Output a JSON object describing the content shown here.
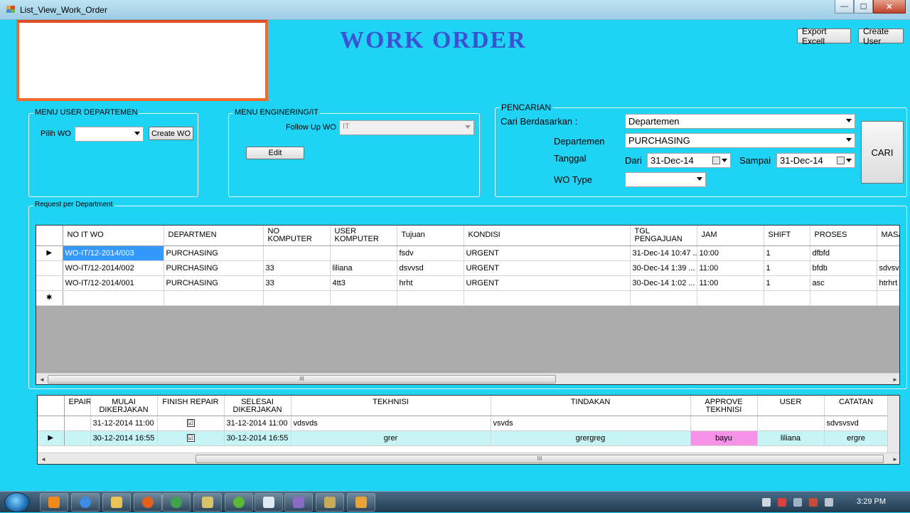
{
  "window": {
    "title": "List_View_Work_Order",
    "minimize": "—",
    "maximize": "☐",
    "close": "✕"
  },
  "header": {
    "title": "WORK ORDER",
    "export_label": "Export Excell",
    "create_user_label": "Create User"
  },
  "menu_user": {
    "group_label": "MENU USER DEPARTEMEN",
    "pilih_wo_label": "Pilih WO",
    "pilih_wo_value": "",
    "create_wo_label": "Create WO"
  },
  "menu_it": {
    "group_label": "MENU ENGINERING/IT",
    "follow_up_label": "Follow Up WO",
    "follow_up_value": "IT",
    "edit_label": "Edit"
  },
  "search": {
    "group_label": "PENCARIAN",
    "cari_berdasarkan_label": "Cari Berdasarkan  :",
    "cari_berdasarkan_value": "Departemen",
    "departemen_label": "Departemen",
    "departemen_value": "PURCHASING",
    "tanggal_label": "Tanggal",
    "dari_label": "Dari",
    "dari_value": "31-Dec-14",
    "sampai_label": "Sampai",
    "sampai_value": "31-Dec-14",
    "wo_type_label": "WO Type",
    "wo_type_value": "",
    "cari_label": "CARI"
  },
  "request": {
    "group_label": "Request per Department",
    "columns": [
      "NO IT WO",
      "DEPARTMEN",
      "NO KOMPUTER",
      "USER KOMPUTER",
      "Tujuan",
      "KONDISI",
      "TGL PENGAJUAN",
      "JAM",
      "SHIFT",
      "PROSES",
      "MASA"
    ],
    "rows": [
      {
        "marker": "▶",
        "cells": [
          "WO-IT/12-2014/003",
          "PURCHASING",
          "",
          "",
          "fsdv",
          "URGENT",
          "31-Dec-14 10:47 ...",
          "10:00",
          "1",
          "dfbfd",
          ""
        ]
      },
      {
        "marker": "",
        "cells": [
          "WO-IT/12-2014/002",
          "PURCHASING",
          "33",
          "liliana",
          "dsvvsd",
          "URGENT",
          "30-Dec-14 1:39 ...",
          "11:00",
          "1",
          "bfdb",
          "sdvsvd"
        ]
      },
      {
        "marker": "",
        "cells": [
          "WO-IT/12-2014/001",
          "PURCHASING",
          "33",
          "4tt3",
          "hrht",
          "URGENT",
          "30-Dec-14 1:02 ...",
          "11:00",
          "1",
          "asc",
          "htrhrt"
        ]
      }
    ],
    "new_row_marker": "✱"
  },
  "repair": {
    "columns": [
      "EPAIR",
      "MULAI DIKERJAKAN",
      "FINISH REPAIR",
      "SELESAI DIKERJAKAN",
      "TEKHNISI",
      "TINDAKAN",
      "APPROVE TEKHNISI",
      "USER",
      "CATATAN"
    ],
    "rows": [
      {
        "marker": "",
        "cells": [
          "",
          "31-12-2014  11:00",
          "☑",
          "31-12-2014  11:00",
          "vdsvds",
          "vsvds",
          "",
          "",
          "sdvsvsvd"
        ]
      },
      {
        "marker": "▶",
        "cells": [
          "",
          "30-12-2014  16:55",
          "☑",
          "30-12-2014  16:55",
          "grer",
          "grergreg",
          "bayu",
          "liliana",
          "ergre"
        ]
      }
    ]
  },
  "scrollbar_thumb": "III",
  "taskbar": {
    "clock": "3:29 PM"
  },
  "colors": {
    "background": "#1fd3f4",
    "title": "#3a53d6",
    "logo_border": "#f26a2a",
    "selected_cell": "#3399ff",
    "approve_cell": "#f591e7",
    "row_highlight": "#c7f4f4"
  }
}
